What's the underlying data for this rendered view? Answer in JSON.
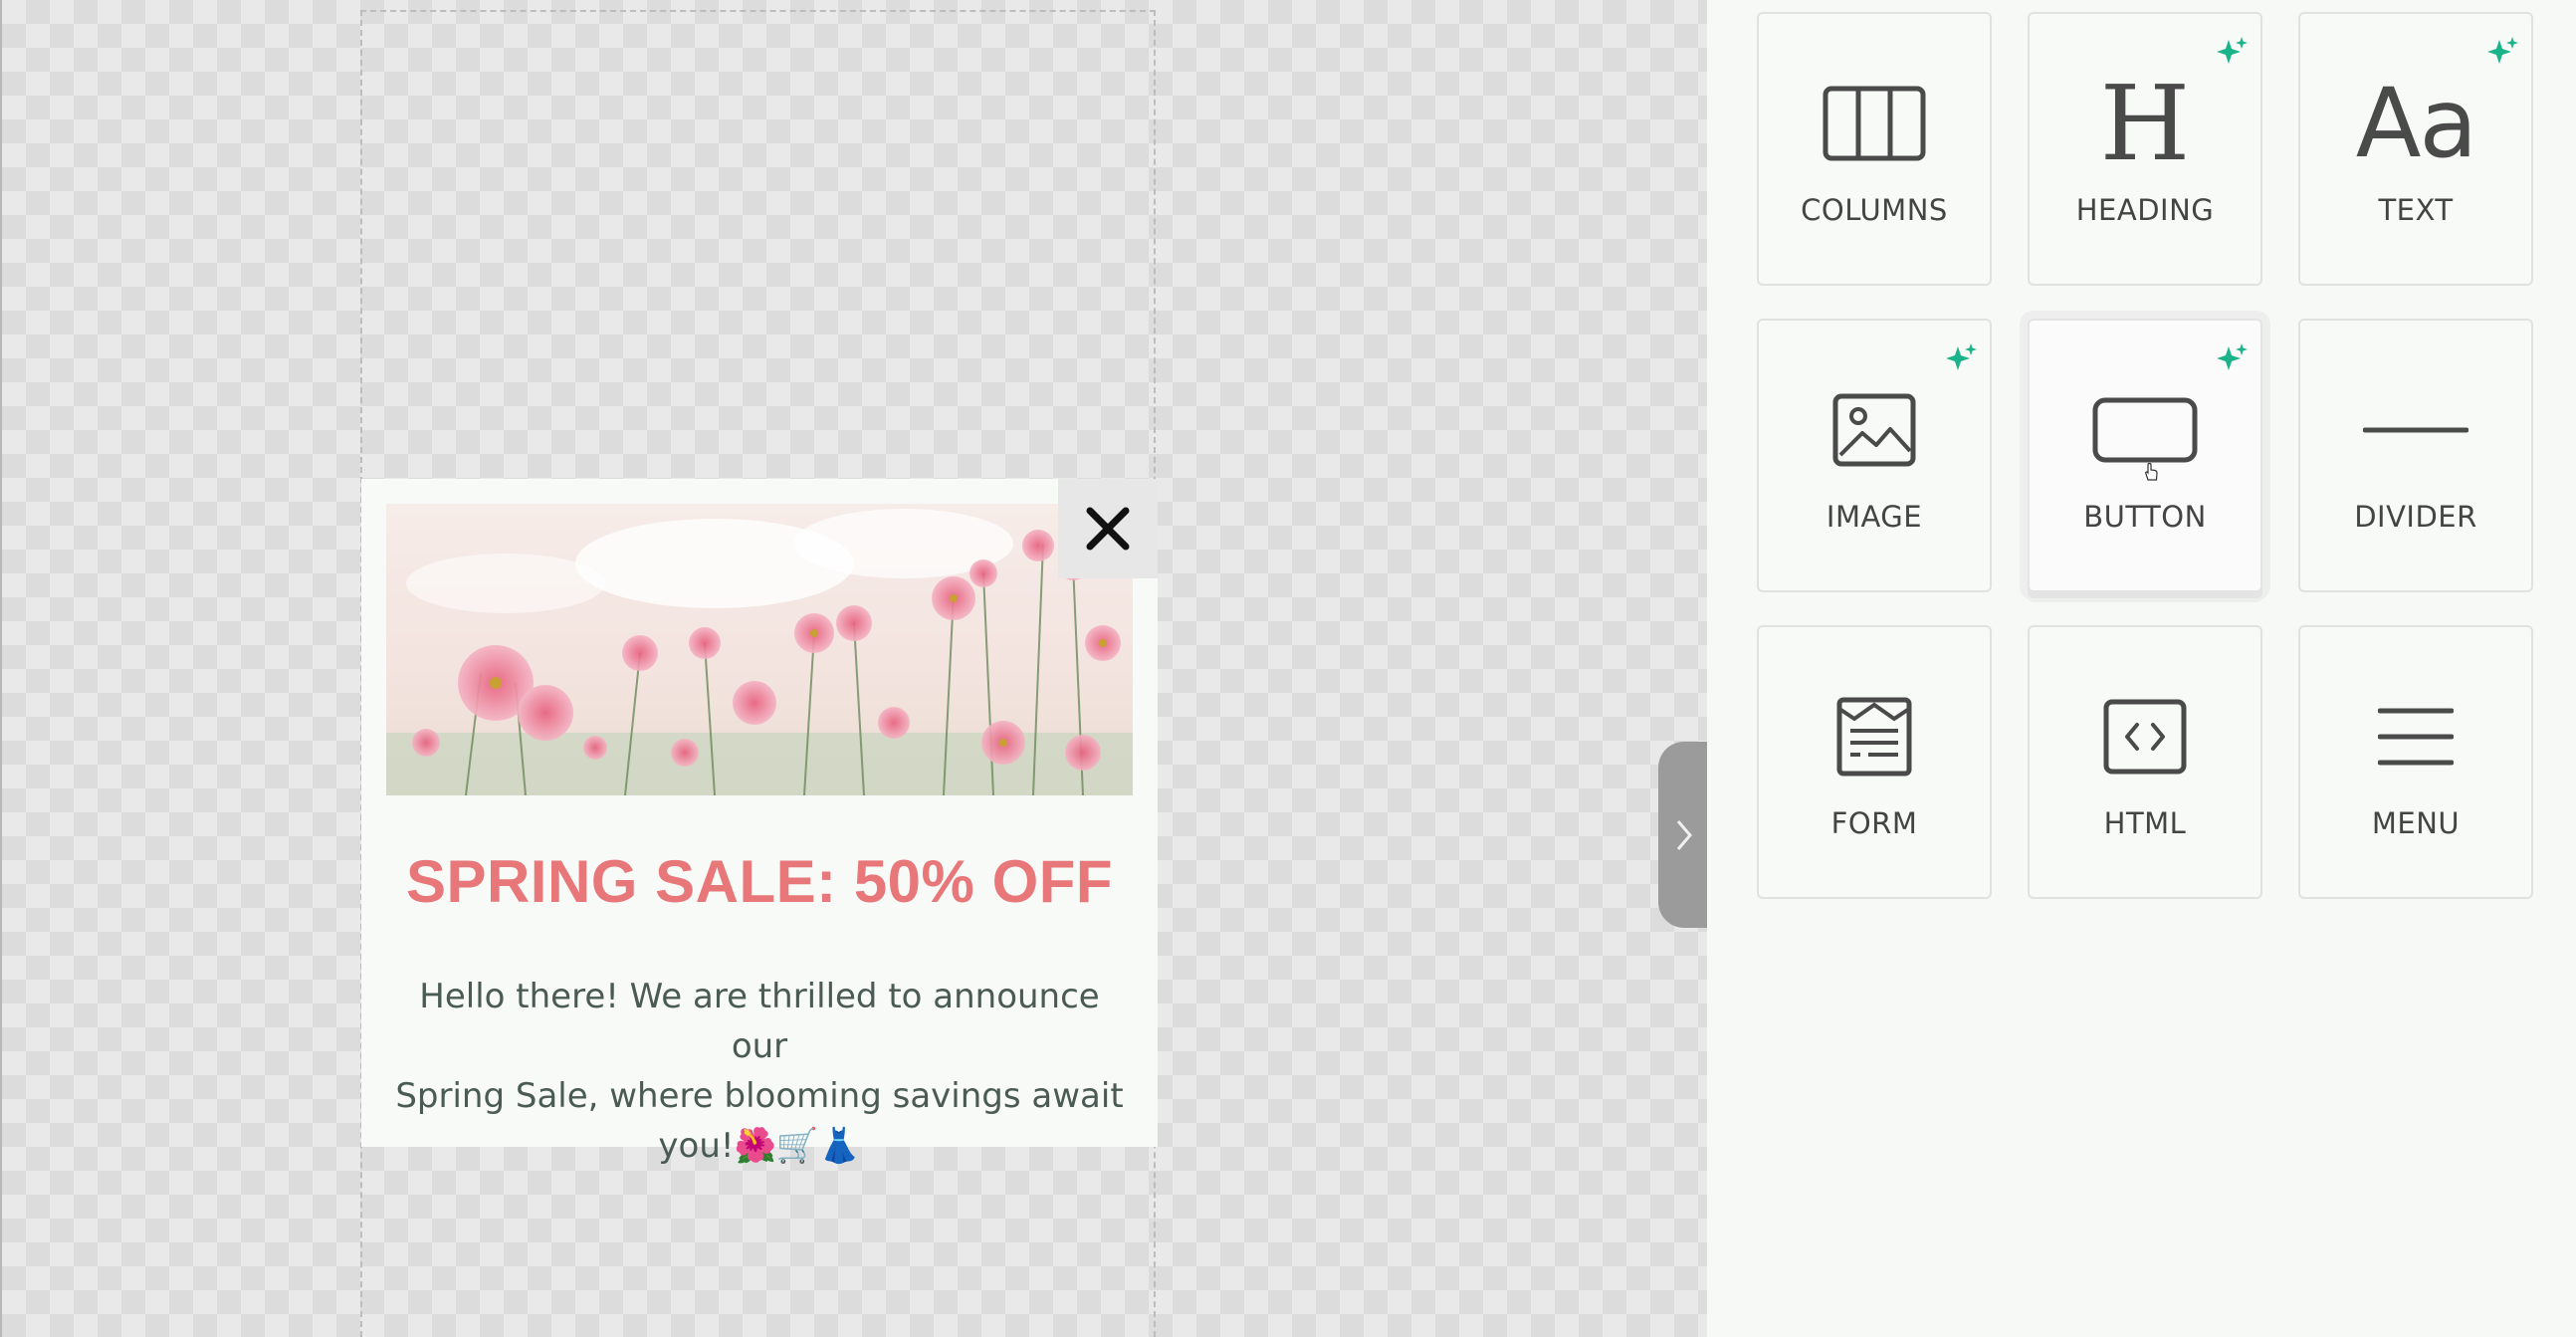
{
  "popup": {
    "close_symbol": "✕",
    "headline": "SPRING SALE: 50% OFF",
    "body_line1": "Hello there! We are thrilled to announce our",
    "body_line2": "Spring Sale, where blooming savings await",
    "body_line3": "you!",
    "emojis": [
      "🌺",
      "🛒",
      "👗"
    ]
  },
  "colors": {
    "headline": "#e8777a",
    "accent_sparkle": "#1bb38a",
    "icon_stroke": "#4a4a4a"
  },
  "sidebar": {
    "tiles": [
      {
        "label": "COLUMNS",
        "icon": "columns-icon",
        "ai": false
      },
      {
        "label": "HEADING",
        "icon": "heading-icon",
        "ai": true
      },
      {
        "label": "TEXT",
        "icon": "text-icon",
        "ai": true
      },
      {
        "label": "IMAGE",
        "icon": "image-icon",
        "ai": true
      },
      {
        "label": "BUTTON",
        "icon": "button-icon",
        "ai": true
      },
      {
        "label": "DIVIDER",
        "icon": "divider-icon",
        "ai": false
      },
      {
        "label": "FORM",
        "icon": "form-icon",
        "ai": false
      },
      {
        "label": "HTML",
        "icon": "html-icon",
        "ai": false
      },
      {
        "label": "MENU",
        "icon": "menu-icon",
        "ai": false
      }
    ],
    "heading_glyph": "H",
    "text_glyph": "Aa"
  }
}
